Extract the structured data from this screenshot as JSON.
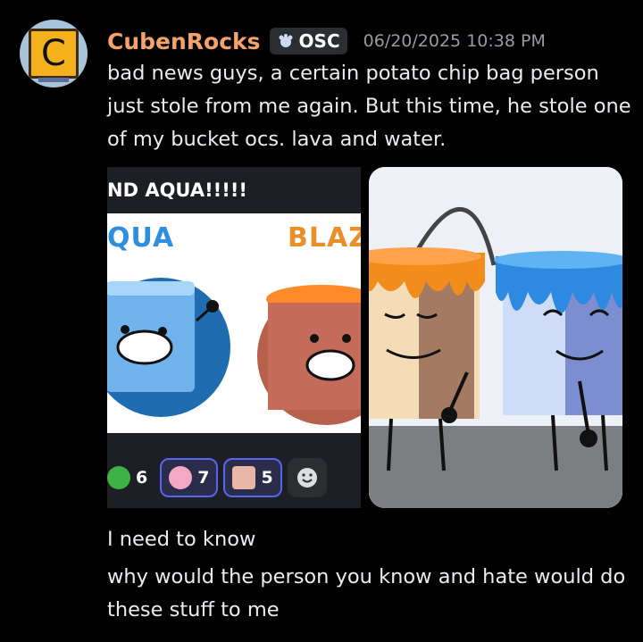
{
  "message": {
    "avatar_letter": "C",
    "username": "CubenRocks",
    "tag": "OSC",
    "timestamp": "06/20/2025 10:38 PM",
    "lines": [
      "bad news guys, a certain potato chip bag person",
      "just stole from me again. But this time, he stole one",
      "of my bucket ocs. lava and water."
    ]
  },
  "attachment_left": {
    "caption": "ND AQUA!!!!!",
    "label_left": "QUA",
    "label_right": "BLAZ",
    "reactions": [
      {
        "icon": "green-blob-emoji",
        "count": "6"
      },
      {
        "icon": "brain-emoji",
        "count": "7"
      },
      {
        "icon": "pink-card-emoji",
        "count": "5"
      }
    ],
    "add_reaction_icon": "smiley-add-reaction-icon"
  },
  "attachment_right": {
    "description_icon": "lava-and-water-buckets-image"
  },
  "followups": [
    "I need to know",
    "why would the person you know and hate would do these stuff to me"
  ],
  "colors": {
    "background": "#000000",
    "username": "#f7a26a",
    "reaction_border": "#5865f2",
    "water": "#2f8ee0",
    "lava": "#e8902a"
  }
}
